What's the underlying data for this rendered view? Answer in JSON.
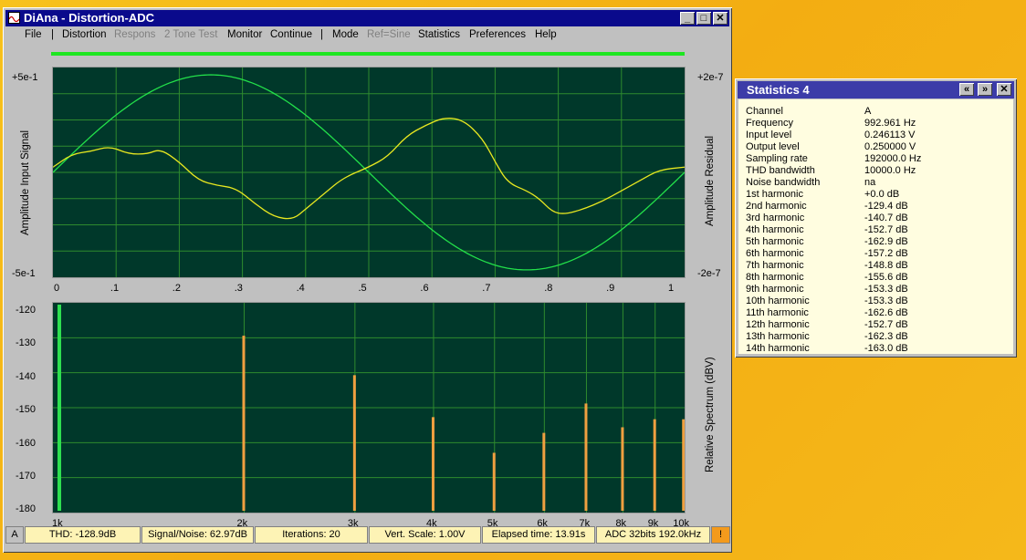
{
  "window": {
    "title": "DiAna - Distortion-ADC",
    "menu": [
      {
        "label": "File",
        "enabled": true
      },
      {
        "label": "|",
        "enabled": true
      },
      {
        "label": "Distortion",
        "enabled": true
      },
      {
        "label": "Respons",
        "enabled": false
      },
      {
        "label": "2 Tone Test",
        "enabled": false
      },
      {
        "label": "Monitor",
        "enabled": true
      },
      {
        "label": "Continue",
        "enabled": true
      },
      {
        "label": "|",
        "enabled": true
      },
      {
        "label": "Mode",
        "enabled": true
      },
      {
        "label": "Ref=Sine",
        "enabled": false
      },
      {
        "label": "Statistics",
        "enabled": true
      },
      {
        "label": "Preferences",
        "enabled": true
      },
      {
        "label": "Help",
        "enabled": true
      }
    ],
    "buttons": {
      "minimize": "_",
      "maximize": "□",
      "close": "✕"
    }
  },
  "top_plot": {
    "left_top": "+5e-1",
    "left_bottom": "-5e-1",
    "right_top": "+2e-7",
    "right_bottom": "-2e-7",
    "ylabel_left": "Amplitude Input Signal",
    "ylabel_right": "Amplitude Residual",
    "xticks": [
      "0",
      ".1",
      ".2",
      ".3",
      ".4",
      ".5",
      ".6",
      ".7",
      ".8",
      ".9",
      "1"
    ]
  },
  "bottom_plot": {
    "yticks": [
      "-120",
      "-130",
      "-140",
      "-150",
      "-160",
      "-170",
      "-180"
    ],
    "ylabel_right": "Relative Spectrum (dBV)",
    "xticks": [
      "1k",
      "2k",
      "3k",
      "4k",
      "5k",
      "6k",
      "7k",
      "8k",
      "9k",
      "10k"
    ]
  },
  "chart_data": [
    {
      "type": "line",
      "x_range": [
        0,
        1
      ],
      "series": [
        {
          "axis": "left",
          "color": "#22e04a",
          "x": [
            0,
            0.25,
            0.5,
            0.75,
            1
          ],
          "y": [
            0,
            0.5,
            0,
            -0.5,
            0
          ],
          "ylim": [
            -0.5,
            0.5
          ]
        },
        {
          "axis": "right",
          "color": "#e8e820",
          "ylim": [
            -2e-07,
            2e-07
          ],
          "x": [
            0,
            0.03,
            0.06,
            0.09,
            0.12,
            0.15,
            0.17,
            0.2,
            0.23,
            0.26,
            0.29,
            0.32,
            0.35,
            0.38,
            0.4,
            0.43,
            0.46,
            0.5,
            0.53,
            0.56,
            0.59,
            0.62,
            0.65,
            0.68,
            0.7,
            0.72,
            0.75,
            0.77,
            0.79,
            0.81,
            0.84,
            0.87,
            0.9,
            0.93,
            0.96,
            1
          ],
          "y": [
            1e-08,
            3.5e-08,
            4e-08,
            5e-08,
            3.5e-08,
            3.5e-08,
            4.5e-08,
            2e-08,
            -1.5e-08,
            -2.5e-08,
            -3e-08,
            -6e-08,
            -8.5e-08,
            -9e-08,
            -7e-08,
            -4e-08,
            -1e-08,
            1e-08,
            3e-08,
            7e-08,
            9e-08,
            1.05e-07,
            1e-07,
            6.5e-08,
            2e-08,
            -2e-08,
            -3.5e-08,
            -5e-08,
            -7.5e-08,
            -8e-08,
            -7e-08,
            -5.5e-08,
            -3.5e-08,
            -1.5e-08,
            5e-09,
            1e-08
          ]
        }
      ]
    },
    {
      "type": "bar",
      "xscale": "log",
      "ylim": [
        -180,
        -120
      ],
      "fundamental": {
        "freq": 1000,
        "db": 0
      },
      "harmonics": [
        {
          "freq": 2000,
          "db": -129.4
        },
        {
          "freq": 3000,
          "db": -140.7
        },
        {
          "freq": 4000,
          "db": -152.7
        },
        {
          "freq": 5000,
          "db": -162.9
        },
        {
          "freq": 6000,
          "db": -157.2
        },
        {
          "freq": 7000,
          "db": -148.8
        },
        {
          "freq": 8000,
          "db": -155.6
        },
        {
          "freq": 9000,
          "db": -153.3
        },
        {
          "freq": 10000,
          "db": -153.3
        }
      ]
    }
  ],
  "status": {
    "channel": "A",
    "thd": "THD: -128.9dB",
    "snr": "Signal/Noise:  62.97dB",
    "iterations": "Iterations: 20",
    "vscale": "Vert. Scale: 1.00V",
    "elapsed": "Elapsed time: 13.91s",
    "adc": "ADC 32bits 192.0kHz",
    "warn": "!"
  },
  "stats": {
    "title": "Statistics 4",
    "buttons": {
      "prev": "«",
      "next": "»",
      "close": "✕"
    },
    "rows": [
      {
        "k": "Channel",
        "v": "A"
      },
      {
        "k": "Frequency",
        "v": "992.961 Hz"
      },
      {
        "k": "Input level",
        "v": "0.246113 V"
      },
      {
        "k": "Output level",
        "v": "0.250000 V"
      },
      {
        "k": "Sampling rate",
        "v": "192000.0 Hz"
      },
      {
        "k": "THD bandwidth",
        "v": "10000.0 Hz"
      },
      {
        "k": "Noise bandwidth",
        "v": "na"
      },
      {
        "k": "1st harmonic",
        "v": "+0.0 dB"
      },
      {
        "k": "2nd harmonic",
        "v": "-129.4 dB"
      },
      {
        "k": "3rd harmonic",
        "v": "-140.7 dB"
      },
      {
        "k": "4th harmonic",
        "v": "-152.7 dB"
      },
      {
        "k": "5th harmonic",
        "v": "-162.9 dB"
      },
      {
        "k": "6th harmonic",
        "v": "-157.2 dB"
      },
      {
        "k": "7th harmonic",
        "v": "-148.8 dB"
      },
      {
        "k": "8th harmonic",
        "v": "-155.6 dB"
      },
      {
        "k": "9th harmonic",
        "v": "-153.3 dB"
      },
      {
        "k": "10th harmonic",
        "v": "-153.3 dB"
      },
      {
        "k": "11th harmonic",
        "v": "-162.6 dB"
      },
      {
        "k": "12th harmonic",
        "v": "-152.7 dB"
      },
      {
        "k": "13th harmonic",
        "v": "-162.3 dB"
      },
      {
        "k": "14th harmonic",
        "v": "-163.0 dB"
      }
    ]
  }
}
